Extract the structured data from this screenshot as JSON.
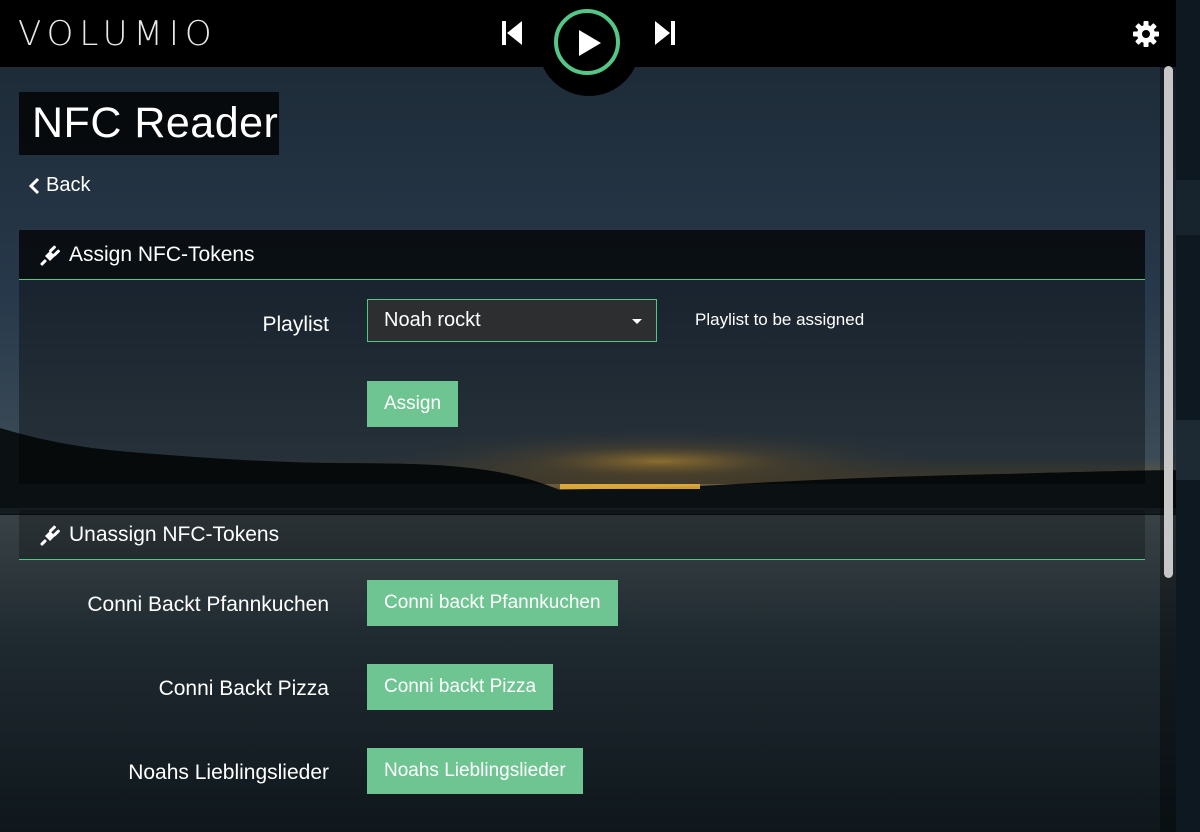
{
  "header": {
    "logo_text": "VOLUMIO",
    "prev_icon": "skip-back-icon",
    "play_icon": "play-icon",
    "next_icon": "skip-forward-icon",
    "settings_icon": "gear-icon",
    "accent_color": "#54c686"
  },
  "page": {
    "title": "NFC Reader",
    "back_label": "Back"
  },
  "assign_section": {
    "title": "Assign NFC-Tokens",
    "icon": "plug-icon",
    "playlist_label": "Playlist",
    "playlist_value": "Noah rockt",
    "playlist_help": "Playlist to be assigned",
    "assign_button": "Assign"
  },
  "unassign_section": {
    "title": "Unassign NFC-Tokens",
    "icon": "plug-icon",
    "rows": [
      {
        "label": "Conni Backt Pfannkuchen",
        "button": "Conni backt Pfannkuchen"
      },
      {
        "label": "Conni Backt Pizza",
        "button": "Conni backt Pizza"
      },
      {
        "label": "Noahs Lieblingslieder",
        "button": "Noahs Lieblingslieder"
      }
    ]
  }
}
